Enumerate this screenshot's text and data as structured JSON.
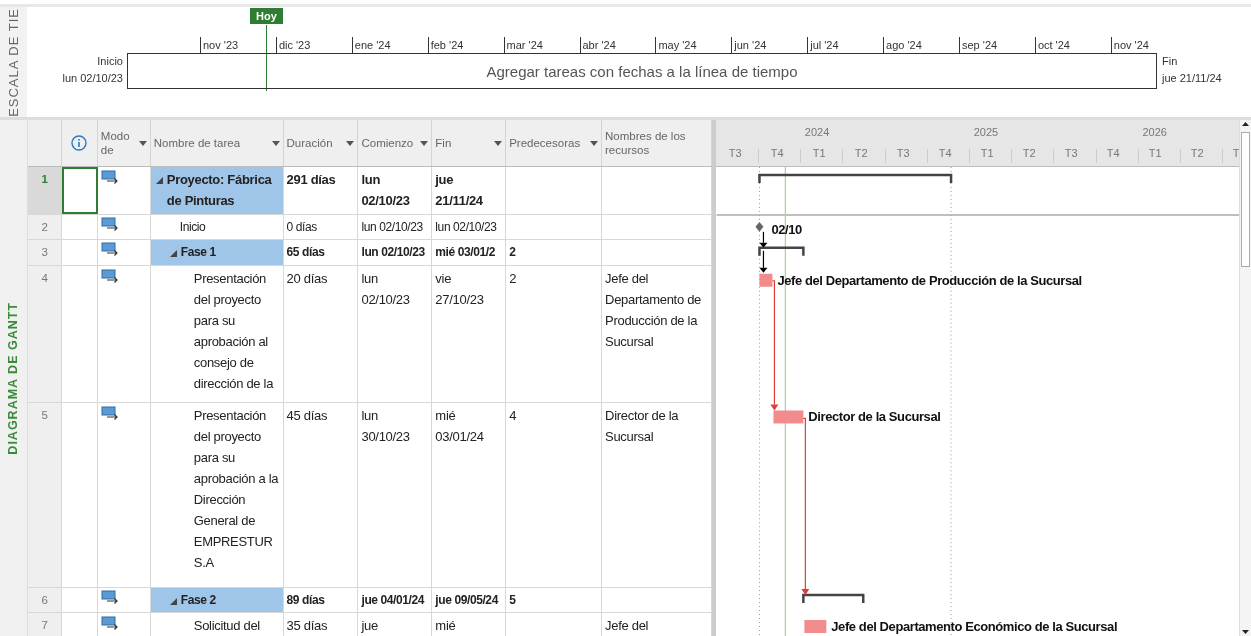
{
  "timeline": {
    "side_label": "ESCALA DE TIE",
    "today_label": "Hoy",
    "months": [
      "nov '23",
      "dic '23",
      "ene '24",
      "feb '24",
      "mar '24",
      "abr '24",
      "may '24",
      "jun '24",
      "jul '24",
      "ago '24",
      "sep '24",
      "oct '24",
      "nov '24"
    ],
    "start_label": "Inicio",
    "start_date": "lun 02/10/23",
    "end_label": "Fin",
    "end_date": "jue 21/11/24",
    "message": "Agregar tareas con fechas a la línea de tiempo"
  },
  "view_label": "DIAGRAMA DE GANTT",
  "table": {
    "columns": [
      {
        "kind": "info"
      },
      {
        "label": "Modo de",
        "kind": "dropdown"
      },
      {
        "label": "Nombre de tarea",
        "kind": "dropdown"
      },
      {
        "label": "Duración",
        "kind": "dropdown"
      },
      {
        "label": "Comienzo",
        "kind": "dropdown"
      },
      {
        "label": "Fin",
        "kind": "dropdown"
      },
      {
        "label": "Predecesoras",
        "kind": "dropdown"
      },
      {
        "label": "Nombres de los recursos",
        "kind": "plain"
      }
    ],
    "tasks": [
      {
        "number": "1",
        "kind": "summary",
        "expanded": true,
        "selected": true,
        "name": "Proyecto: Fábrica de Pinturas",
        "duration": "291 días",
        "start": "lun 02/10/23",
        "finish": "jue 21/11/24",
        "children": [
          {
            "number": "2",
            "kind": "milestone",
            "selected": false,
            "name": "Inicio",
            "duration": "0 días",
            "start": "lun 02/10/23",
            "finish": "lun 02/10/23",
            "bar_label": "02/10"
          },
          {
            "number": "3",
            "kind": "summary",
            "expanded": true,
            "selected": false,
            "name": "Fase 1",
            "duration": "65 días",
            "start": "lun 02/10/23",
            "finish": "mié 03/01/2",
            "predecessors": "2",
            "children": [
              {
                "number": "4",
                "kind": "task",
                "selected": false,
                "name": "Presentación del proyecto para su aprobación al consejo de dirección de la",
                "duration": "20 días",
                "start": "lun 02/10/23",
                "finish": "vie 27/10/23",
                "predecessors": "2",
                "resources": "Jefe del Departamento de Producción de la Sucursal",
                "bar_label": "Jefe del Departamento de Producción de la Sucursal"
              },
              {
                "number": "5",
                "kind": "task",
                "selected": false,
                "name": "Presentación del proyecto para su aprobación a la Dirección General de EMPRESTUR S.A",
                "duration": "45 días",
                "start": "lun 30/10/23",
                "finish": "mié 03/01/24",
                "predecessors": "4",
                "resources": "Director de la Sucursal",
                "bar_label": "Director de la Sucursal"
              }
            ]
          },
          {
            "number": "6",
            "kind": "summary",
            "expanded": true,
            "selected": false,
            "name": "Fase 2",
            "duration": "89 días",
            "start": "jue 04/01/24",
            "finish": "jue 09/05/24",
            "predecessors": "5",
            "children": [
              {
                "number": "7",
                "kind": "task",
                "selected": false,
                "name": "Solicitud del",
                "duration": "35 días",
                "start": "jue",
                "finish": "mié",
                "resources": "Jefe del",
                "bar_label": "Jefe del Departamento Económico de la Sucursal"
              }
            ]
          }
        ]
      }
    ]
  },
  "gantt": {
    "years": [
      "2024",
      "2025",
      "2026"
    ],
    "quarters": [
      "T3",
      "T4",
      "T1",
      "T2",
      "T3",
      "T4",
      "T1",
      "T2",
      "T3",
      "T4",
      "T1",
      "T2",
      "T"
    ]
  }
}
